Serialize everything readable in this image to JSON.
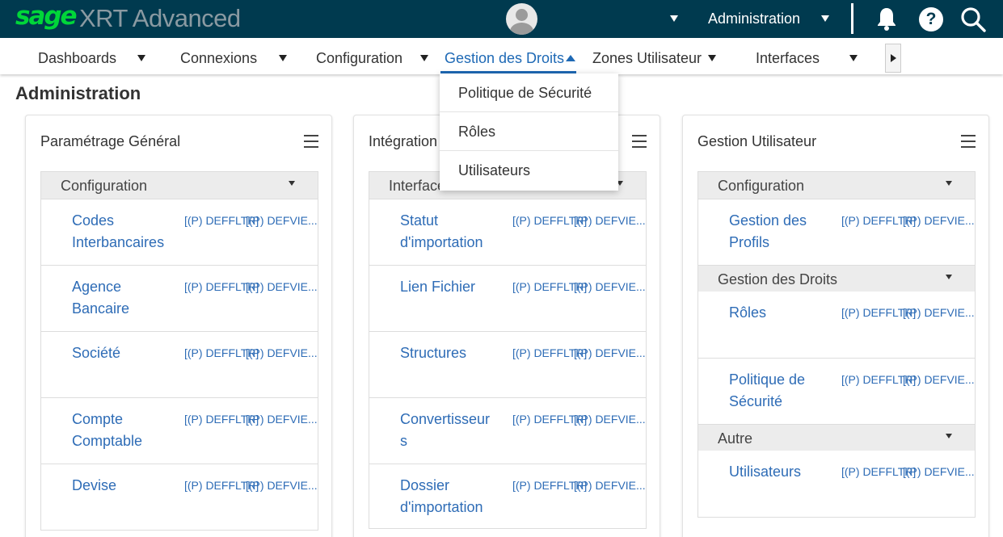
{
  "header": {
    "logo": "sage",
    "app_title": "XRT Advanced",
    "user_menu": "Administration"
  },
  "nav": {
    "items": [
      {
        "label": "Dashboards"
      },
      {
        "label": "Connexions"
      },
      {
        "label": "Configuration"
      },
      {
        "label": "Gestion des Droits",
        "active": true
      },
      {
        "label": "Zones Utilisateur"
      },
      {
        "label": "Interfaces"
      }
    ]
  },
  "dropdown": {
    "items": [
      "Politique de Sécurité",
      "Rôles",
      "Utilisateurs"
    ]
  },
  "page": {
    "title": "Administration"
  },
  "cards": [
    {
      "title": "Paramétrage Général",
      "sections": [
        {
          "header": "Configuration",
          "rows": [
            {
              "label": "Codes Interbancaires",
              "p1": "[(P) DEFFLTR]",
              "p2": "[(P) DEFVIE..."
            },
            {
              "label": "Agence Bancaire",
              "p1": "[(P) DEFFLTR]",
              "p2": "[(P) DEFVIE..."
            },
            {
              "label": "Société",
              "p1": "[(P) DEFFLTR]",
              "p2": "[(P) DEFVIE..."
            },
            {
              "label": "Compte Comptable",
              "p1": "[(P) DEFFLTR]",
              "p2": "[(P) DEFVIE..."
            },
            {
              "label": "Devise",
              "p1": "[(P) DEFFLTR]",
              "p2": "[(P) DEFVIE..."
            }
          ]
        }
      ]
    },
    {
      "title": "Intégration",
      "sections": [
        {
          "header": "Interfaces",
          "rows": [
            {
              "label": "Statut d'importation",
              "p1": "[(P) DEFFLTR]",
              "p2": "[(P) DEFVIE..."
            },
            {
              "label": "Lien Fichier",
              "p1": "[(P) DEFFLTR]",
              "p2": "[(P) DEFVIE..."
            },
            {
              "label": "Structures",
              "p1": "[(P) DEFFLTR]",
              "p2": "[(P) DEFVIE..."
            },
            {
              "label": "Convertisseurs",
              "p1": "[(P) DEFFLTR]",
              "p2": "[(P) DEFVIE..."
            },
            {
              "label": "Dossier d'importation",
              "p1": "[(P) DEFFLTR]",
              "p2": "[(P) DEFVIE..."
            }
          ]
        }
      ]
    },
    {
      "title": "Gestion Utilisateur",
      "sections": [
        {
          "header": "Configuration",
          "rows": [
            {
              "label": "Gestion des Profils",
              "p1": "[(P) DEFFLTR]",
              "p2": "[(P) DEFVIE..."
            }
          ]
        },
        {
          "header": "Gestion des Droits",
          "rows": [
            {
              "label": "Rôles",
              "p1": "[(P) DEFFLTR]",
              "p2": "[(P) DEFVIE..."
            },
            {
              "label": "Politique de Sécurité",
              "p1": "[(P) DEFFLTR]",
              "p2": "[(P) DEFVIE..."
            }
          ]
        },
        {
          "header": "Autre",
          "rows": [
            {
              "label": "Utilisateurs",
              "p1": "[(P) DEFFLTR]",
              "p2": "[(P) DEFVIE..."
            }
          ]
        }
      ]
    }
  ]
}
